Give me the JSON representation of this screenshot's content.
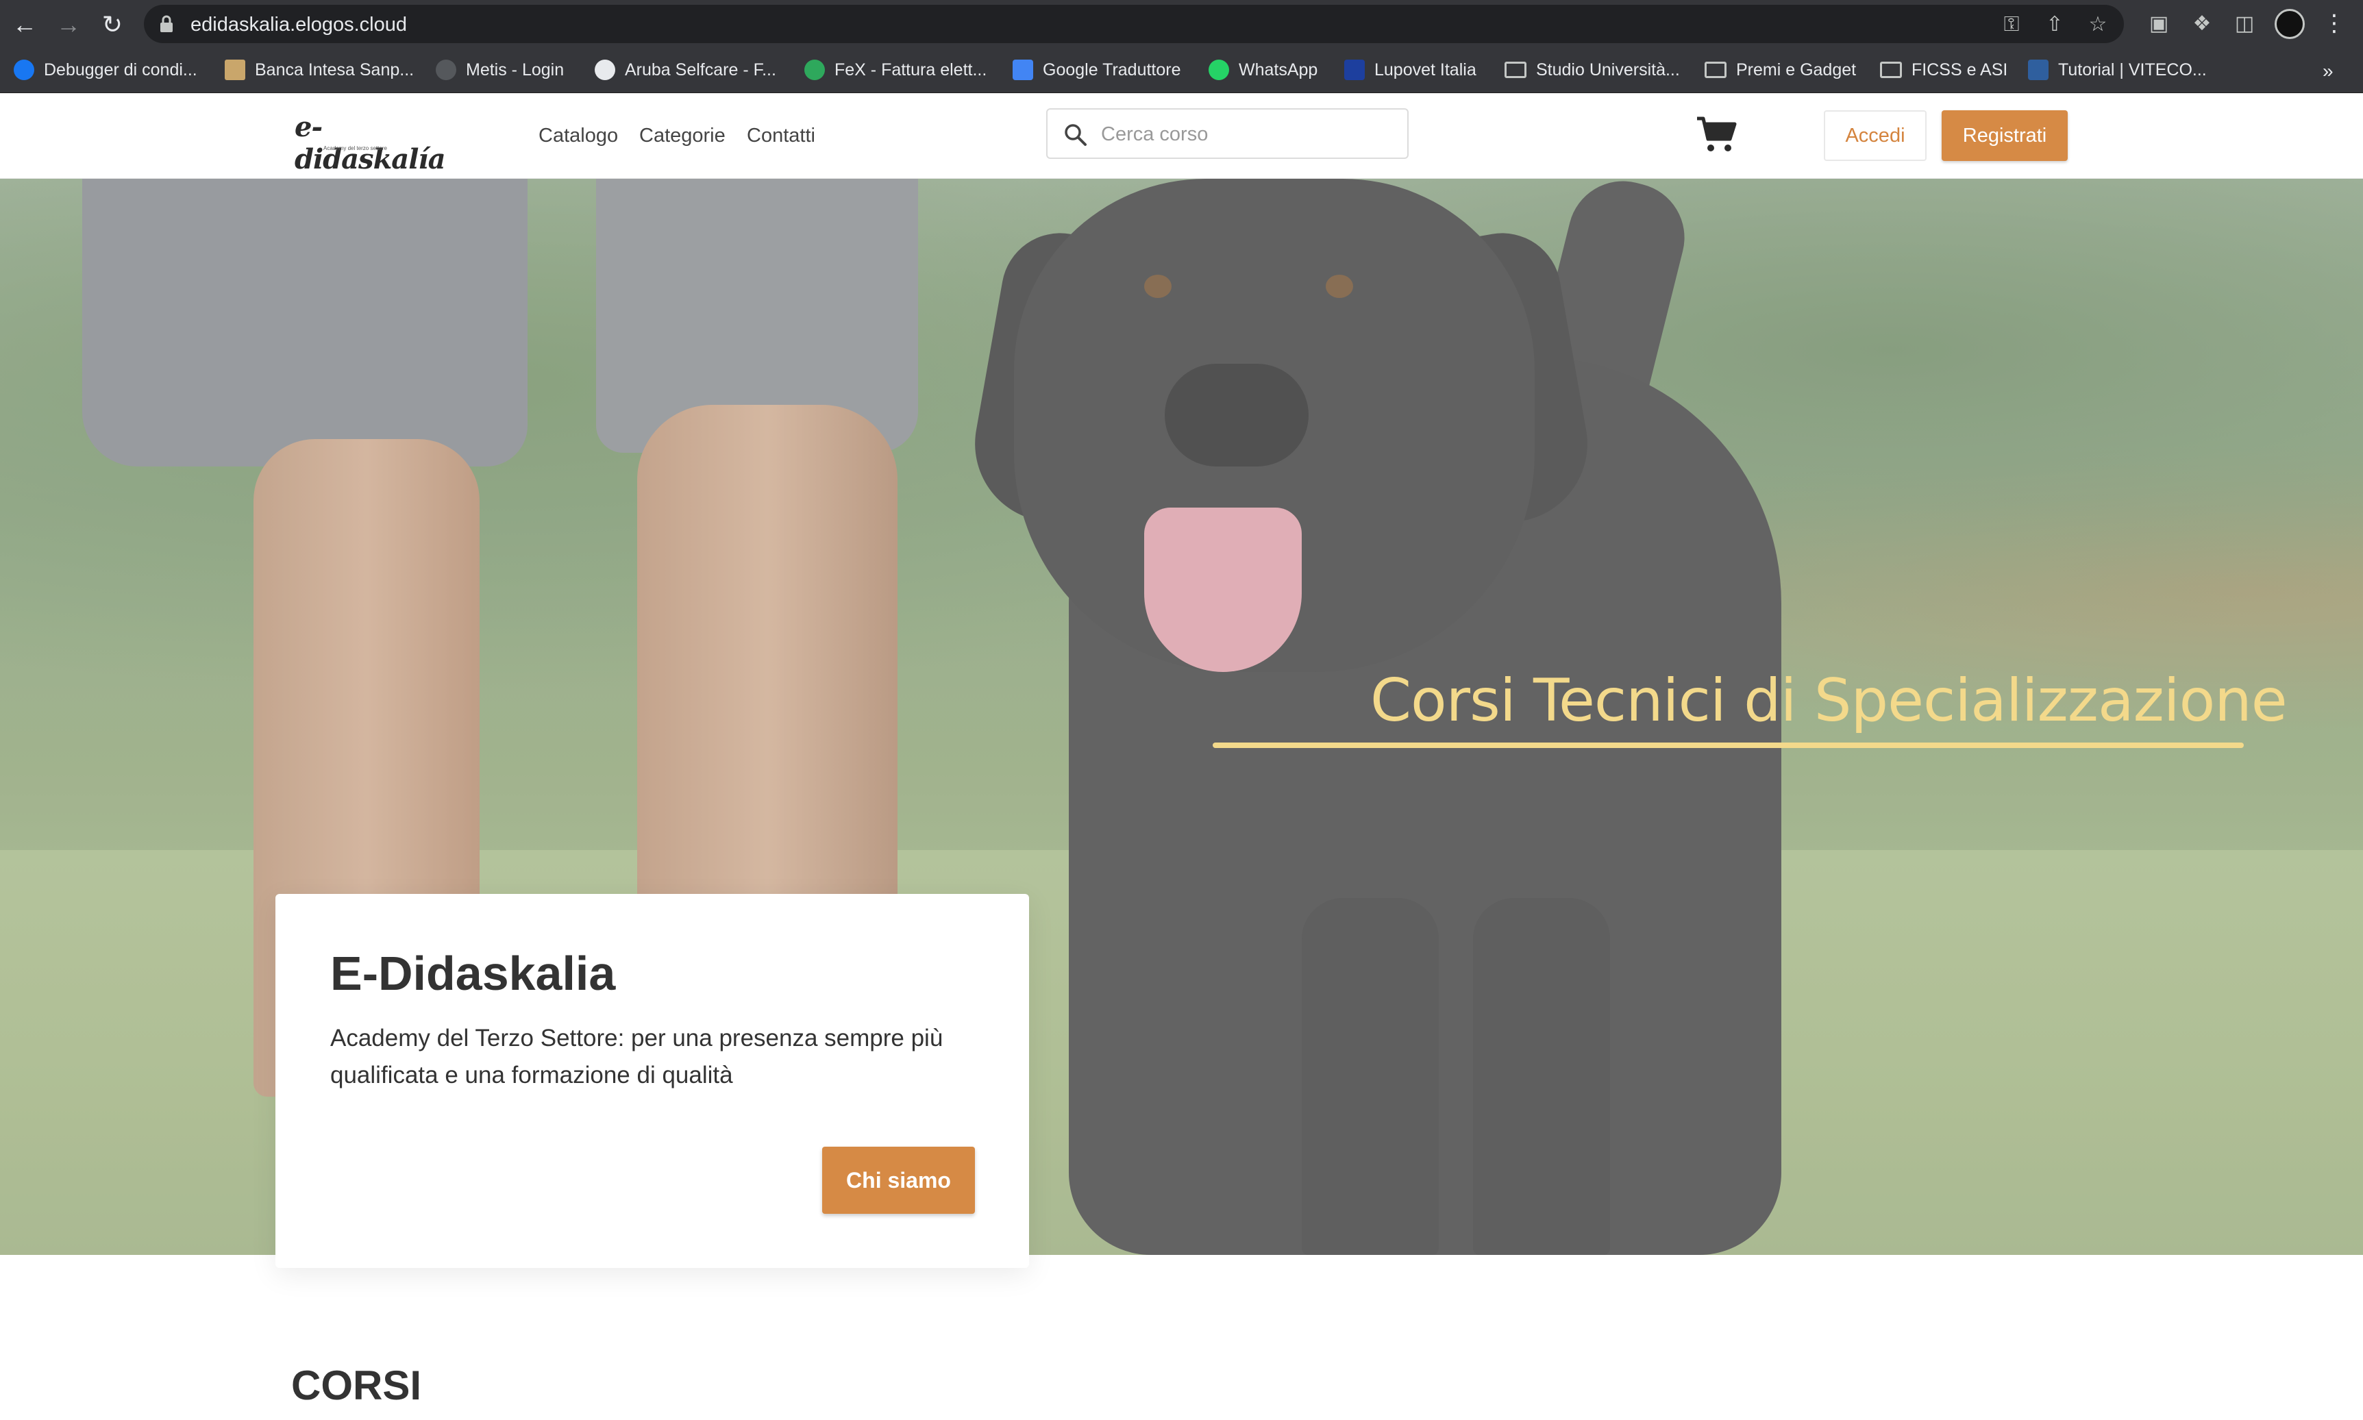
{
  "browser": {
    "url": "edidaskalia.elogos.cloud",
    "bookmarks": [
      {
        "label": "Debugger di condi...",
        "icon": "facebook-icon"
      },
      {
        "label": "Banca Intesa Sanp...",
        "icon": "bank-icon"
      },
      {
        "label": "Metis - Login",
        "icon": "metis-icon"
      },
      {
        "label": "Aruba Selfcare - F...",
        "icon": "aruba-icon"
      },
      {
        "label": "FeX - Fattura elett...",
        "icon": "fex-icon"
      },
      {
        "label": "Google Traduttore",
        "icon": "google-translate-icon"
      },
      {
        "label": "WhatsApp",
        "icon": "whatsapp-icon"
      },
      {
        "label": "Lupovet Italia",
        "icon": "lupovet-icon"
      },
      {
        "label": "Studio Università...",
        "icon": "folder-icon"
      },
      {
        "label": "Premi e Gadget",
        "icon": "folder-icon"
      },
      {
        "label": "FICSS e ASI",
        "icon": "folder-icon"
      },
      {
        "label": "Tutorial | VITECO...",
        "icon": "viteco-icon"
      }
    ],
    "more_label": "»"
  },
  "header": {
    "logo_text": "e-didaskalía",
    "logo_subtitle": "Academy del terzo settore",
    "nav": {
      "catalogo": "Catalogo",
      "categorie": "Categorie",
      "contatti": "Contatti"
    },
    "search_placeholder": "Cerca corso",
    "accedi_label": "Accedi",
    "registrati_label": "Registrati"
  },
  "hero": {
    "tagline": "Corsi Tecnici di Specializzazione",
    "card_title": "E-Didaskalia",
    "card_text": "Academy del Terzo Settore: per una presenza sempre più qualificata e una formazione di qualità",
    "cta_label": "Chi siamo"
  },
  "main": {
    "section_title": "CORSI"
  },
  "colors": {
    "accent": "#d68a45",
    "tagline": "#f3d98b",
    "chrome": "#35363a"
  }
}
